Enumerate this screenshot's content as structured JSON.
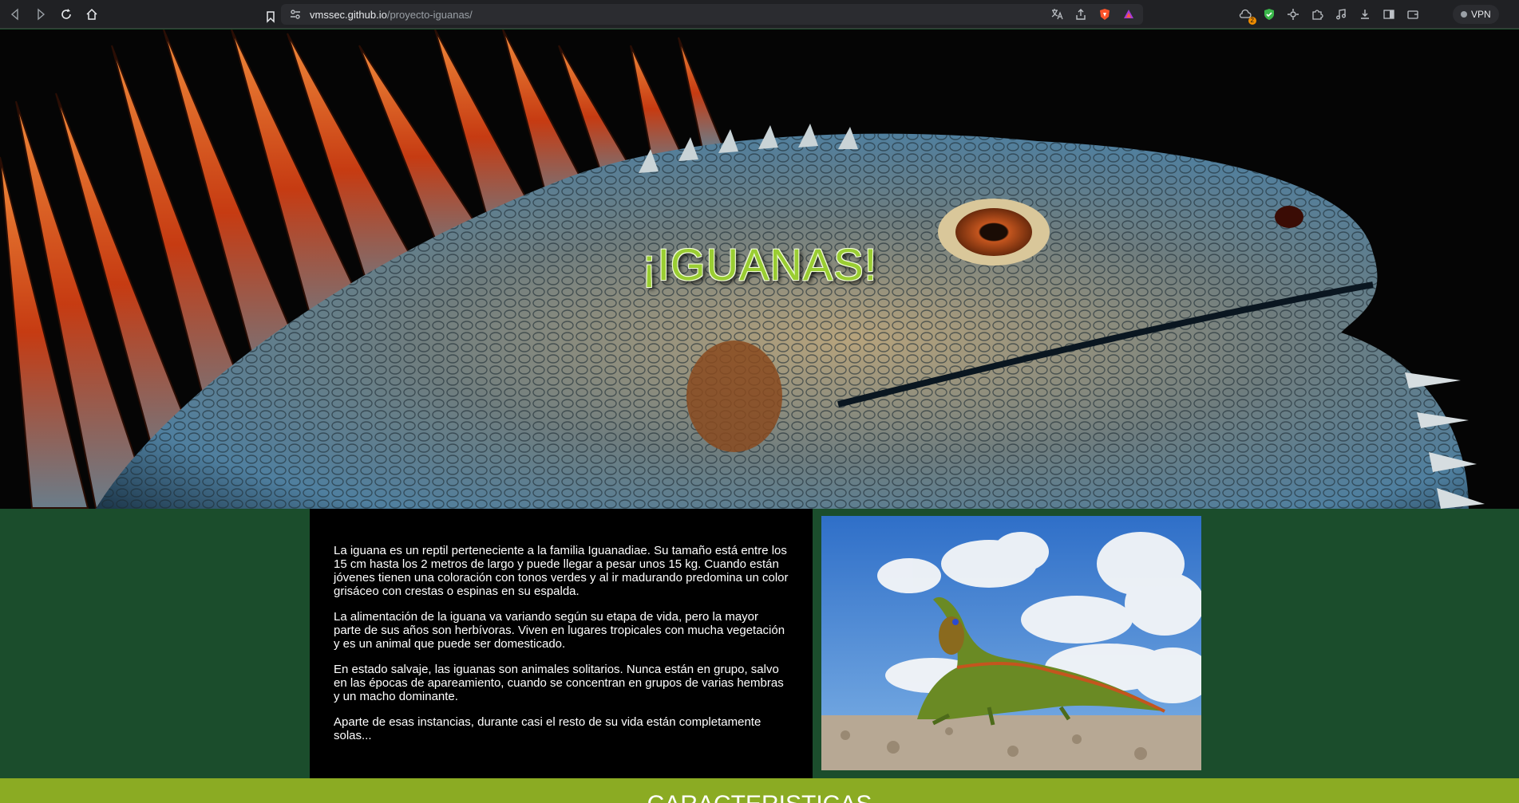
{
  "browser": {
    "url_host": "vmssec.github.io",
    "url_path": "/proyecto-iguanas/",
    "vpn_label": "VPN",
    "extension_badge": "2"
  },
  "hero": {
    "title": "¡IGUANAS!"
  },
  "intro": {
    "paragraphs": [
      "La iguana es un reptil perteneciente a la familia Iguanadiae. Su tamaño está entre los 15 cm hasta los 2 metros de largo y puede llegar a pesar unos 15 kg. Cuando están jóvenes tienen una coloración con tonos verdes y al ir madurando predomina un color grisáceo con crestas o espinas en su espalda.",
      "La alimentación de la iguana va variando según su etapa de vida, pero la mayor parte de sus años son herbívoras. Viven en lugares tropicales con mucha vegetación y es un animal que puede ser domesticado.",
      "En estado salvaje, las iguanas son animales solitarios. Nunca están en grupo, salvo en las épocas de apareamiento, cuando se concentran en grupos de varias hembras y un macho dominante.",
      "Aparte de esas instancias, durante casi el resto de su vida están completamente solas..."
    ]
  },
  "next_section": {
    "heading": "CARACTERISTICAS"
  },
  "colors": {
    "page_bg": "#1b4d2c",
    "accent_green": "#8bab23",
    "title_green": "#9acd32"
  }
}
